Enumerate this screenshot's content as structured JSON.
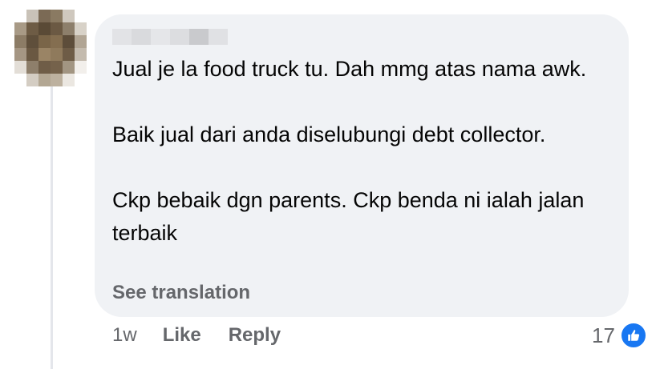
{
  "comment": {
    "text_paragraphs": [
      "Jual je la food truck tu. Dah mmg atas nama awk.",
      "Baik jual dari anda diselubungi debt collector.",
      "Ckp bebaik dgn parents. Ckp benda ni ialah jalan terbaik"
    ],
    "see_translation": "See translation"
  },
  "actions": {
    "time": "1w",
    "like": "Like",
    "reply": "Reply"
  },
  "reactions": {
    "count": "17",
    "icon": "thumbs-up-icon"
  },
  "colors": {
    "bubble": "#f0f2f5",
    "secondary_text": "#65676b",
    "like_blue": "#1877f2"
  }
}
